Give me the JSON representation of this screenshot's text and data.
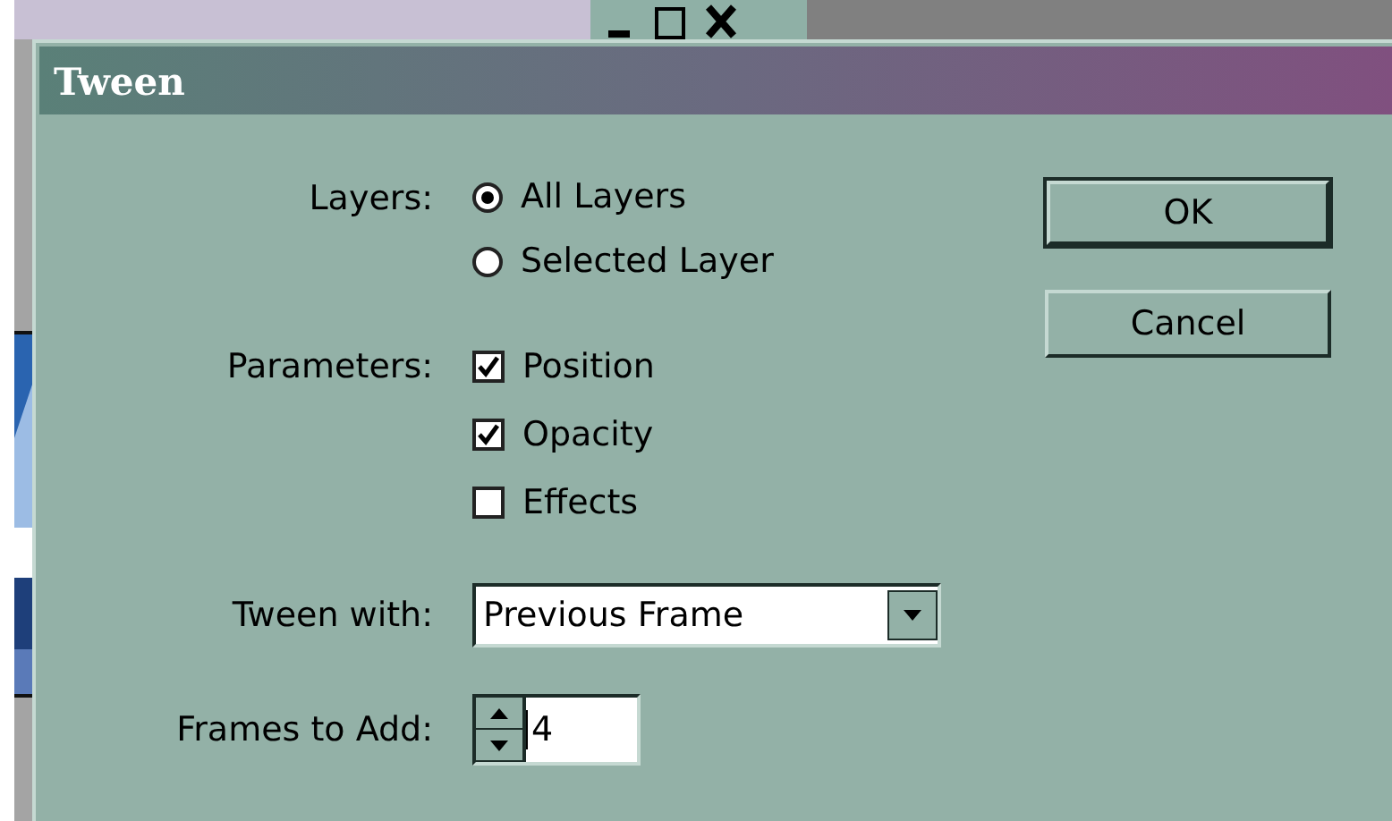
{
  "dialog": {
    "title": "Tween",
    "layers": {
      "label": "Layers:",
      "options": [
        {
          "label": "All Layers",
          "selected": true
        },
        {
          "label": "Selected Layer",
          "selected": false
        }
      ]
    },
    "parameters": {
      "label": "Parameters:",
      "options": [
        {
          "label": "Position",
          "checked": true
        },
        {
          "label": "Opacity",
          "checked": true
        },
        {
          "label": "Effects",
          "checked": false
        }
      ]
    },
    "tween_with": {
      "label": "Tween with:",
      "value": "Previous Frame"
    },
    "frames_to_add": {
      "label": "Frames to Add:",
      "value": "4"
    },
    "buttons": [
      {
        "label": "OK",
        "default": true
      },
      {
        "label": "Cancel",
        "default": false
      }
    ]
  }
}
